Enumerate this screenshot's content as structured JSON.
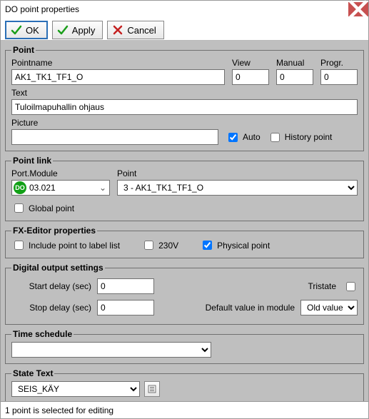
{
  "window": {
    "title": "DO point properties"
  },
  "toolbar": {
    "ok": "OK",
    "apply": "Apply",
    "cancel": "Cancel"
  },
  "point": {
    "legend": "Point",
    "pointname_label": "Pointname",
    "pointname_value": "AK1_TK1_TF1_O",
    "view_label": "View",
    "view_value": "0",
    "manual_label": "Manual",
    "manual_value": "0",
    "progr_label": "Progr.",
    "progr_value": "0",
    "text_label": "Text",
    "text_value": "Tuloilmapuhallin ohjaus",
    "picture_label": "Picture",
    "picture_value": "",
    "auto_label": "Auto",
    "auto_checked": true,
    "history_label": "History point",
    "history_checked": false
  },
  "pointlink": {
    "legend": "Point link",
    "portmodule_label": "Port.Module",
    "do_badge": "DO",
    "portmodule_value": "03.021",
    "point_label": "Point",
    "point_value": "3 - AK1_TK1_TF1_O",
    "global_label": "Global point",
    "global_checked": false
  },
  "fx": {
    "legend": "FX-Editor properties",
    "labellist_label": "Include point to label list",
    "labellist_checked": false,
    "v230_label": "230V",
    "v230_checked": false,
    "physical_label": "Physical point",
    "physical_checked": true
  },
  "dos": {
    "legend": "Digital output settings",
    "startdelay_label": "Start delay (sec)",
    "startdelay_value": "0",
    "stopdelay_label": "Stop delay (sec)",
    "stopdelay_value": "0",
    "tristate_label": "Tristate",
    "tristate_checked": false,
    "defaultmod_label": "Default value in module",
    "oldvalue_value": "Old value"
  },
  "ts": {
    "legend": "Time schedule",
    "value": ""
  },
  "st": {
    "legend": "State Text",
    "value": "SEIS_KÄY"
  },
  "status": "1 point is selected for editing"
}
